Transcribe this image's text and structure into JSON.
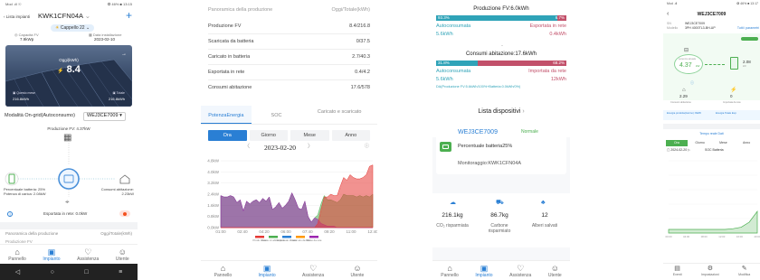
{
  "s1": {
    "status_left": "Mod .ıll ☉",
    "status_right": "✪ 46% ■ 13:15",
    "back": "Lista impianti",
    "title": "KWK1CFN04A",
    "badge": "Cappello 22",
    "cap_label": "Capacità FV",
    "cap_value": "7.9kWp",
    "date_label": "Data installazione",
    "date_value": "2023-02-10",
    "today_label": "Oggi(kWh)",
    "today_value": "8.4",
    "month_value": "216.8kWh",
    "month_label": "Questo mese",
    "total_label": "Totale",
    "total_value": "216.8kWh",
    "mode": "Modalità On-grid(Autoconsumo)",
    "device": "WEJ3CE7009",
    "pv_power": "Produzione FV: 4.37kW",
    "batt_pct": "Percentuale batteria: 25%",
    "batt_power": "Potenza di carica: 2.08kW",
    "cons_label": "Consumi abitazione:",
    "cons_value": "2.23kW",
    "export": "Esportata in rete: 0.0kW",
    "ov_title": "Panoramica della produzione",
    "ov_right": "Oggi/Totale(kWh)",
    "row_cut": "Produzione FV",
    "tabs": [
      "Pannello",
      "Impianto",
      "Assistenza",
      "Utente"
    ]
  },
  "s2": {
    "ov_title": "Panoramica della produzione",
    "ov_right": "Oggi/Totale(kWh)",
    "rows": [
      {
        "label": "Produzione FV",
        "value": "8.4/216.8"
      },
      {
        "label": "Scaricata da batteria",
        "value": "0/37.5"
      },
      {
        "label": "Caricato in batteria",
        "value": "2.7/40.3"
      },
      {
        "label": "Esportata in rete",
        "value": "0.4/4.2"
      },
      {
        "label": "Consumi abitazione",
        "value": "17.6/578"
      }
    ],
    "ctabs": [
      "PotenzaEnergia",
      "SOC",
      "Caricato e scaricato"
    ],
    "periods": [
      "Ora",
      "Giorno",
      "Mese",
      "Anno"
    ],
    "date": "2023-02-20",
    "legend": [
      "Produ zione",
      "Consu mi abita zione",
      "Esport ato in rete",
      "Scaric ato da batt",
      "Preso da rete"
    ],
    "tabs": [
      "Pannello",
      "Impianto",
      "Assistenza",
      "Utente"
    ]
  },
  "s3": {
    "pv_title": "Produzione FV:6.0kWh",
    "pv_left_pct": "93.3%",
    "pv_right_pct": "6.7%",
    "pv_left_label": "Autoconsumata",
    "pv_right_label": "Esportata in rete",
    "pv_left_val": "5.6kWh",
    "pv_right_val": "0.4kWh",
    "cons_title": "Consumi abitazione:17.6kWh",
    "c_left_pct": "31.8%",
    "c_right_pct": "68.2%",
    "c_left_label": "Autoconsumata",
    "c_right_label": "Importata da rete",
    "c_left_val": "5.6kWh",
    "c_right_val": "12kWh",
    "formula": "DA(Produzione FV:5.6kWh/100%+Batteria:0.0kWh/0%)",
    "list_title": "Lista dispositivi",
    "dev_name": "WEJ3CE7009",
    "dev_status": "Normale",
    "dev_batt": "Percentuale batteria25%",
    "dev_mon": "Monitoraggio:KWK1CFN04A",
    "stats": [
      {
        "value": "216.1kg",
        "label": "CO₂ risparmiata"
      },
      {
        "value": "86.7kg",
        "label": "Carbone risparmiato"
      },
      {
        "value": "12",
        "label": "Alberi salvati"
      }
    ],
    "tabs": [
      "Pannello",
      "Impianto",
      "Assistenza",
      "Utente"
    ]
  },
  "s4": {
    "status_left": "Mod .ıll",
    "status_right": "✪ 46% ■ 13:17",
    "title": "WEJ3CE7009",
    "sn_label": "SN",
    "sn_value": "WEJ3CE7009",
    "model_label": "Modello",
    "model_value": "3PH 4000TL3-BH-UP",
    "link": "Tutti i parametri",
    "pv_power_label": "potenza attuale",
    "pv_power": "4.37",
    "batt_val": "2.08",
    "grid_val": "2.29",
    "load_val": "0",
    "grid_label": "Consumi abitazione",
    "load_label": "Importata da rete",
    "flow1": "Energia prodotta(Giorno): 8kWh",
    "flow2": "Energia Totale Esp:",
    "prev": "Tempo reale Dati",
    "periods": [
      "Ora",
      "Giorno",
      "Mese",
      "Anno"
    ],
    "date": "2024-02-20",
    "chart_tab": "SOC Batteria",
    "tabs": [
      "Eventi",
      "Impostazioni",
      "Modifica"
    ]
  },
  "chart_data": [
    {
      "type": "area",
      "title": "",
      "ylabel": "",
      "y_ticks": [
        "4.8kW",
        "4.0kW",
        "3.2kW",
        "2.4kW",
        "1.6kW",
        "0.8kW",
        "0.0kW"
      ],
      "x": [
        "01:00",
        "02:40",
        "04:20",
        "06:00",
        "07:40",
        "09:20",
        "11:00",
        "12:40"
      ],
      "ylim": [
        0,
        4.8
      ],
      "series": [
        {
          "name": "Consumi abitazione",
          "color": "#4caf50",
          "values": [
            2.3,
            2.2,
            2.2,
            2.3,
            2.2,
            1.8,
            2.0,
            1.2,
            1.9,
            1.7,
            1.9,
            2.0,
            1.8,
            2.1,
            1.9,
            2.2,
            1.3,
            1.5,
            1.8,
            1.4,
            1.6,
            1.9,
            2.5,
            2.0,
            1.4,
            1.3,
            1.9,
            0.8,
            0.4,
            0.7,
            0.9,
            1.7,
            2.3,
            2.0,
            2.0,
            1.9,
            1.8,
            2.0,
            2.4,
            2.3,
            2.3,
            2.3,
            2.2,
            2.3,
            2.2,
            2.3,
            2.2,
            2.4
          ]
        },
        {
          "name": "Preso da rete",
          "color": "#9c27b0",
          "values": [
            2.3,
            2.2,
            2.2,
            2.3,
            2.2,
            1.8,
            2.0,
            1.2,
            1.9,
            1.7,
            1.9,
            2.0,
            1.8,
            2.1,
            1.9,
            2.2,
            1.3,
            1.5,
            1.8,
            1.4,
            1.6,
            1.9,
            2.5,
            2.0,
            1.4,
            1.3,
            1.9,
            0.8,
            0.4,
            0.7,
            0.6,
            0.3,
            0.2,
            0.1,
            0.1,
            0.1,
            0,
            0,
            0,
            0,
            0,
            0,
            0,
            0,
            0,
            0,
            0,
            0
          ]
        },
        {
          "name": "Produzione",
          "color": "#e53935",
          "values": [
            0,
            0,
            0,
            0,
            0,
            0,
            0,
            0,
            0,
            0,
            0,
            0,
            0,
            0,
            0,
            0,
            0,
            0,
            0,
            0,
            0,
            0,
            0,
            0,
            0,
            0,
            0,
            0,
            0,
            0,
            0.3,
            1.3,
            2.2,
            2.2,
            2.4,
            2.3,
            2.3,
            3.0,
            3.6,
            3.4,
            3.8,
            3.6,
            3.5,
            3.5,
            3.6,
            3.8,
            4.4,
            4.5
          ]
        }
      ]
    },
    {
      "type": "line",
      "title": "",
      "x": [
        "00:00",
        "04:00",
        "08:00",
        "12:00",
        "16:00",
        "20:00"
      ],
      "ylim": [
        0,
        100
      ],
      "series": [
        {
          "name": "SOC Batteria",
          "color": "#4caf50",
          "values": [
            5,
            5,
            5,
            5,
            5,
            5,
            5,
            5,
            6,
            8,
            15,
            30
          ]
        }
      ]
    }
  ]
}
